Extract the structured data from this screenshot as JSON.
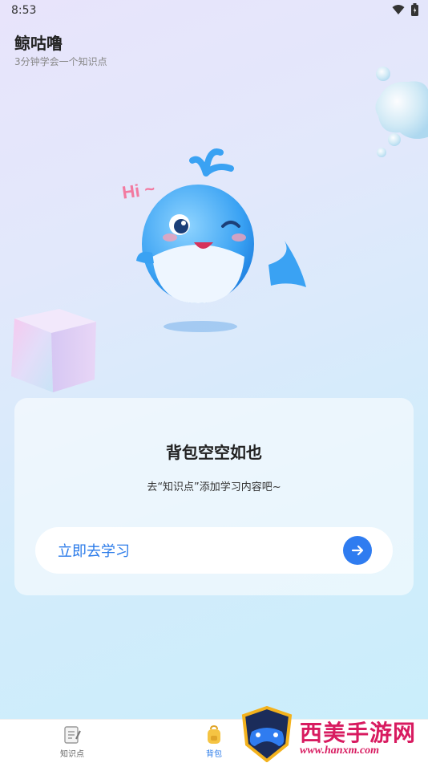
{
  "status_bar": {
    "time": "8:53"
  },
  "app": {
    "title": "鲸咕噜",
    "subtitle": "3分钟学会一个知识点"
  },
  "empty_state": {
    "title": "背包空空如也",
    "hint": "去“知识点”添加学习内容吧~",
    "action_label": "立即去学习"
  },
  "tabs": [
    {
      "label": "知识点",
      "icon": "notebook-icon",
      "active": false
    },
    {
      "label": "背包",
      "icon": "backpack-icon",
      "active": true
    }
  ],
  "watermark": {
    "text": "西美手游网",
    "url": "www.hanxm.com"
  },
  "colors": {
    "accent": "#2f7cf0",
    "watermark": "#d81b60"
  }
}
